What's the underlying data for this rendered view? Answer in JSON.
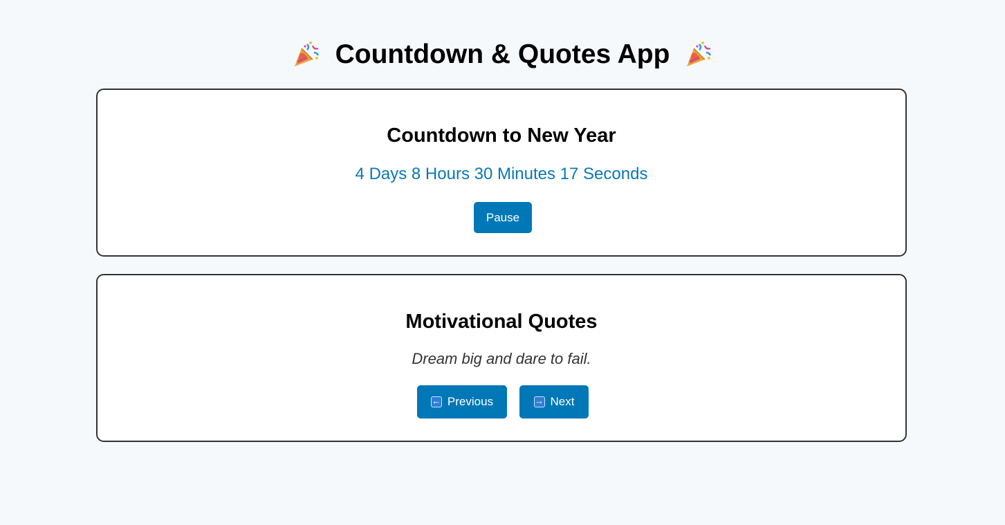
{
  "header": {
    "title": "Countdown & Quotes App",
    "left_icon": "party-popper-icon",
    "right_icon": "party-popper-icon"
  },
  "countdown": {
    "heading": "Countdown to New Year",
    "remaining": "4 Days 8 Hours 30 Minutes 17 Seconds",
    "pause_label": "Pause"
  },
  "quotes": {
    "heading": "Motivational Quotes",
    "current_quote": "Dream big and dare to fail.",
    "previous_label": "Previous",
    "previous_icon": "left-arrow-icon",
    "next_label": "Next",
    "next_icon": "right-arrow-icon"
  },
  "colors": {
    "background": "#f5f9fc",
    "accent": "#0077b6",
    "countdown_text": "#0a78b4",
    "card_border": "#333333"
  }
}
